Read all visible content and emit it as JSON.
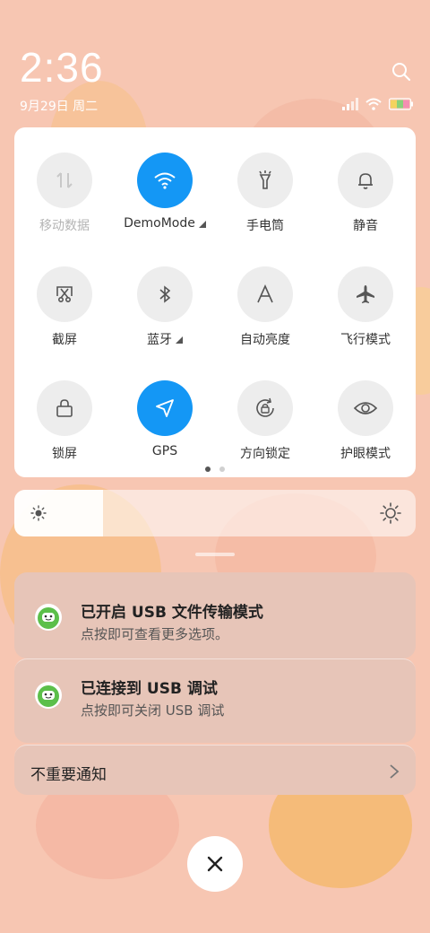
{
  "status": {
    "time": "2:36",
    "date": "9月29日 周二"
  },
  "quick_settings": {
    "tiles": [
      {
        "label": "移动数据",
        "icon": "mobile-data-icon",
        "active": false,
        "disabled": true
      },
      {
        "label": "DemoMode",
        "icon": "wifi-icon",
        "active": true
      },
      {
        "label": "手电筒",
        "icon": "flashlight-icon",
        "active": false
      },
      {
        "label": "静音",
        "icon": "bell-icon",
        "active": false
      },
      {
        "label": "截屏",
        "icon": "screenshot-icon",
        "active": false
      },
      {
        "label": "蓝牙",
        "icon": "bluetooth-icon",
        "active": false
      },
      {
        "label": "自动亮度",
        "icon": "auto-brightness-icon",
        "active": false
      },
      {
        "label": "飞行模式",
        "icon": "airplane-icon",
        "active": false
      },
      {
        "label": "锁屏",
        "icon": "lock-icon",
        "active": false
      },
      {
        "label": "GPS",
        "icon": "location-arrow-icon",
        "active": true
      },
      {
        "label": "方向锁定",
        "icon": "rotation-lock-icon",
        "active": false
      },
      {
        "label": "护眼模式",
        "icon": "eye-icon",
        "active": false
      }
    ],
    "page_count": 2,
    "current_page": 1
  },
  "brightness": {
    "level": 0.22
  },
  "notifications": [
    {
      "title": "已开启 USB 文件传输模式",
      "subtitle": "点按即可查看更多选项。",
      "icon": "android-app-icon"
    },
    {
      "title": "已连接到 USB 调试",
      "subtitle": "点按即可关闭 USB 调试",
      "icon": "android-app-icon"
    }
  ],
  "unimportant": {
    "label": "不重要通知"
  },
  "colors": {
    "accent": "#1497f5",
    "background": "#f7c6b2"
  }
}
